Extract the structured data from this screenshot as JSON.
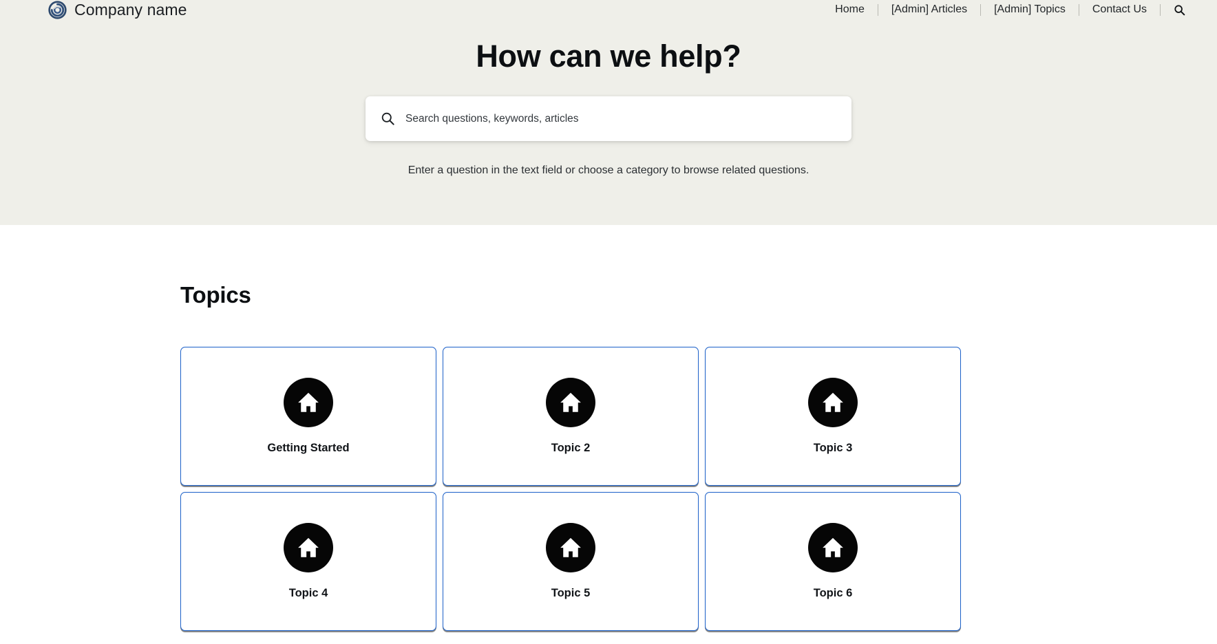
{
  "header": {
    "brand_name": "Company name",
    "logo_icon": "circular-swirl-logo",
    "nav_items": [
      {
        "label": "Home"
      },
      {
        "label": "[Admin] Articles"
      },
      {
        "label": "[Admin] Topics"
      },
      {
        "label": "Contact Us"
      }
    ],
    "search_icon": "search-icon"
  },
  "hero": {
    "title": "How can we help?",
    "search": {
      "placeholder": "Search questions, keywords, articles",
      "value": "",
      "icon": "search-icon"
    },
    "subtitle": "Enter a question in the text field or choose a category to browse related questions."
  },
  "topics": {
    "heading": "Topics",
    "cards": [
      {
        "label": "Getting Started",
        "icon": "home-icon"
      },
      {
        "label": "Topic 2",
        "icon": "home-icon"
      },
      {
        "label": "Topic 3",
        "icon": "home-icon"
      },
      {
        "label": "Topic 4",
        "icon": "home-icon"
      },
      {
        "label": "Topic 5",
        "icon": "home-icon"
      },
      {
        "label": "Topic 6",
        "icon": "home-icon"
      }
    ]
  },
  "colors": {
    "hero_background": "#efefe9",
    "page_background": "#ffffff",
    "card_border": "#1a5fc8",
    "icon_background": "#060606",
    "logo": "#2e4a6e",
    "text": "#15181b"
  }
}
